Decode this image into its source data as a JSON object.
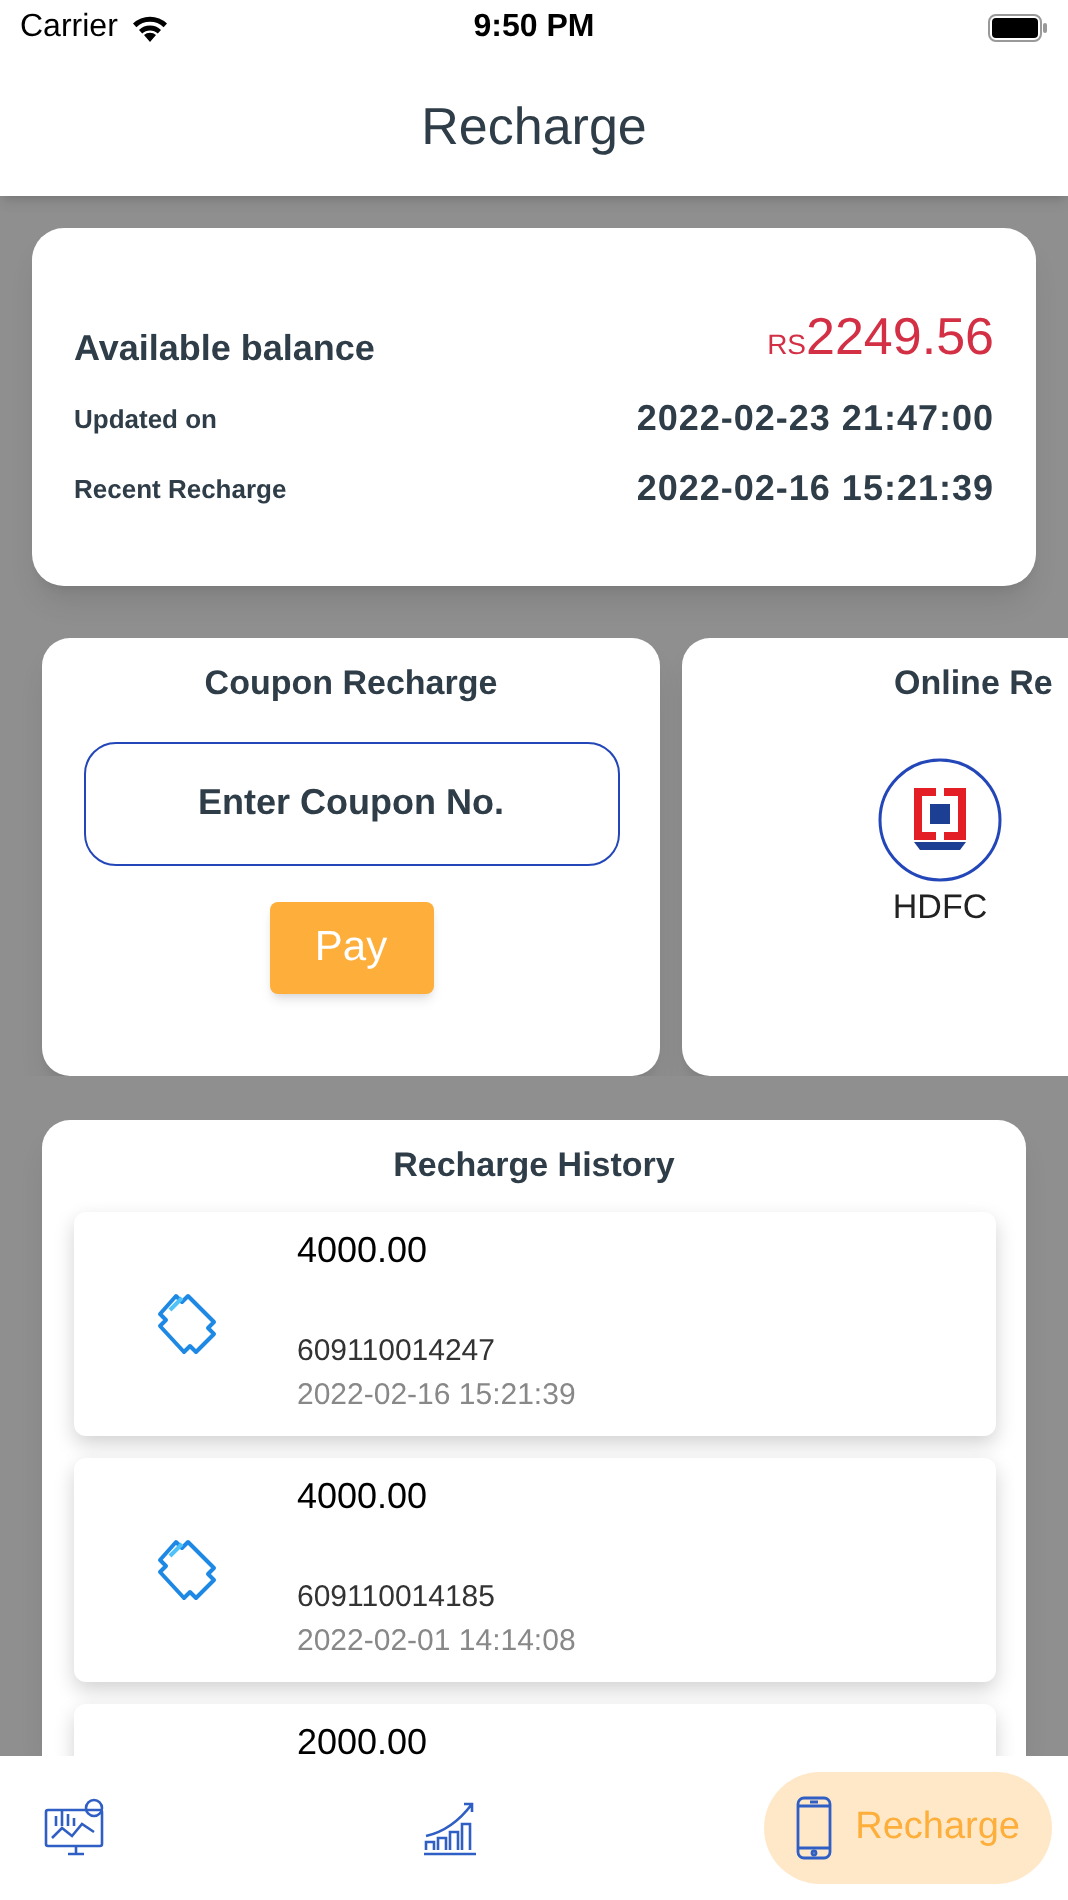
{
  "status_bar": {
    "carrier": "Carrier",
    "time": "9:50 PM"
  },
  "header": {
    "title": "Recharge"
  },
  "balance": {
    "label": "Available balance",
    "currency": "RS",
    "amount": "2249.56",
    "rows": [
      {
        "label": "Updated on",
        "value": "2022-02-23 21:47:00"
      },
      {
        "label": "Recent Recharge",
        "value": "2022-02-16 15:21:39"
      }
    ]
  },
  "coupon": {
    "title": "Coupon Recharge",
    "placeholder": "Enter Coupon No.",
    "button": "Pay"
  },
  "online": {
    "title": "Online Re",
    "banks": [
      {
        "name": "HDFC"
      }
    ]
  },
  "history": {
    "title": "Recharge History",
    "items": [
      {
        "amount": "4000.00",
        "number": "609110014247",
        "date": "2022-02-16 15:21:39"
      },
      {
        "amount": "4000.00",
        "number": "609110014185",
        "date": "2022-02-01 14:14:08"
      },
      {
        "amount": "2000.00"
      }
    ]
  },
  "nav": [
    {
      "kind": "dashboard",
      "selected": false
    },
    {
      "kind": "growth",
      "selected": false
    },
    {
      "kind": "phone",
      "label": "Recharge",
      "selected": true
    }
  ]
}
